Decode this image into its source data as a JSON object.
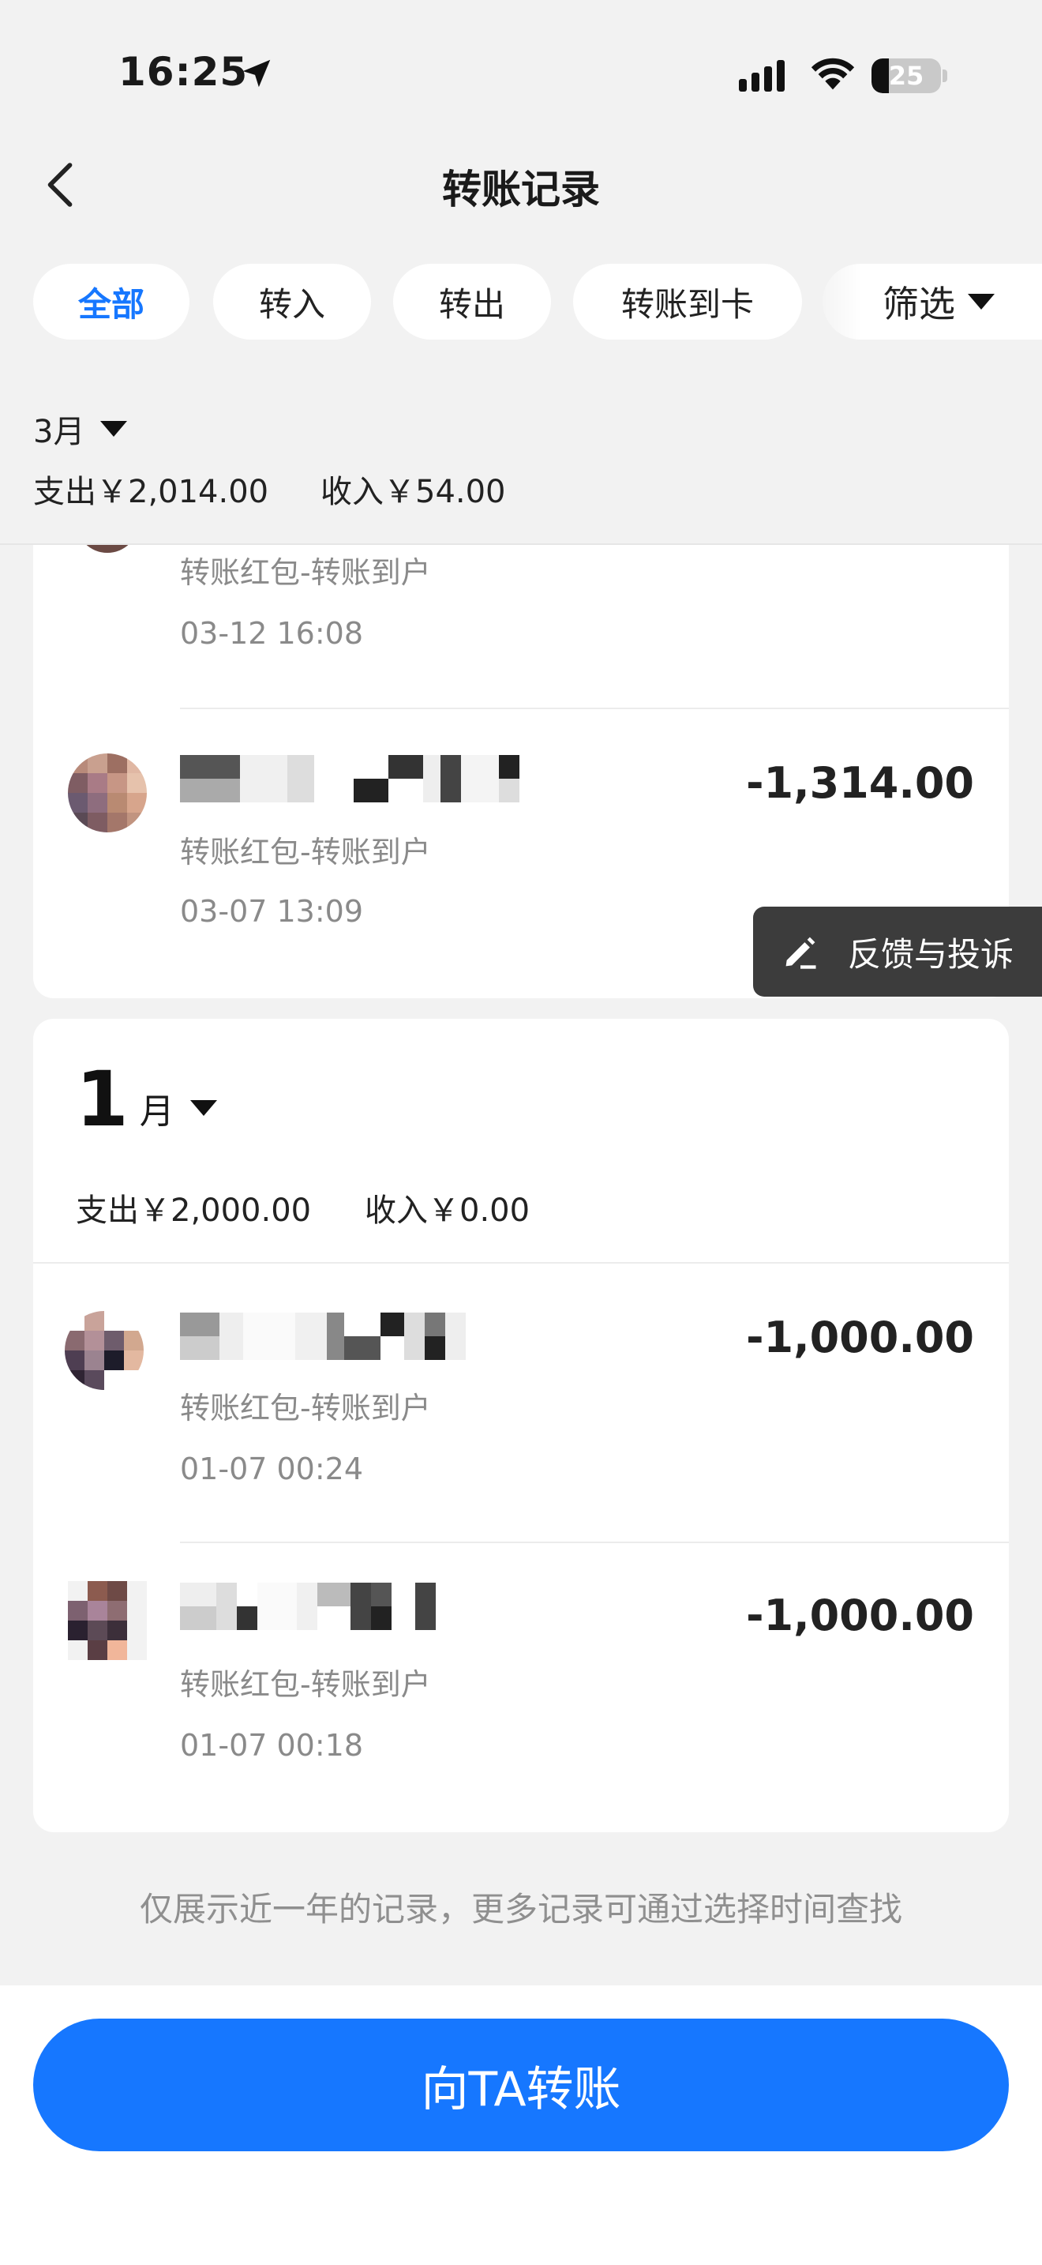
{
  "status_bar": {
    "time": "16:25",
    "battery": "25",
    "battery_level": 0.25
  },
  "nav": {
    "title": "转账记录"
  },
  "filters": {
    "chips": [
      "全部",
      "转入",
      "转出",
      "转账到卡"
    ],
    "active": "全部",
    "filter_label": "筛选"
  },
  "march": {
    "label": "3月",
    "expense": "支出￥2,014.00",
    "income": "收入￥54.00",
    "records": [
      {
        "type": "转账红包-转账到户",
        "time": "03-12 16:08",
        "amount": ""
      },
      {
        "type": "转账红包-转账到户",
        "time": "03-07 13:09",
        "amount": "-1,314.00"
      }
    ]
  },
  "january": {
    "number": "1",
    "unit": "月",
    "expense": "支出￥2,000.00",
    "income": "收入￥0.00",
    "records": [
      {
        "type": "转账红包-转账到户",
        "time": "01-07 00:24",
        "amount": "-1,000.00"
      },
      {
        "type": "转账红包-转账到户",
        "time": "01-07 00:18",
        "amount": "-1,000.00"
      }
    ]
  },
  "feedback": {
    "label": "反馈与投诉"
  },
  "footer_note": "仅展示近一年的记录，更多记录可通过选择时间查找",
  "cta": {
    "label": "向TA转账"
  },
  "colors": {
    "accent": "#1677ff",
    "background": "#f2f2f2"
  }
}
